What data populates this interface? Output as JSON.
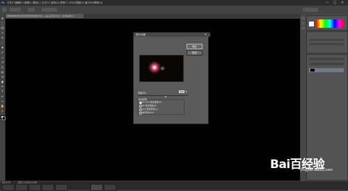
{
  "menubar": {
    "items": [
      "文件(F)",
      "编辑(E)",
      "图像(I)",
      "图层(L)",
      "文字(Y)",
      "选择(S)",
      "滤镜(T)",
      "3D(D)",
      "视图(V)",
      "窗口(W)",
      "帮助(H)"
    ]
  },
  "window_controls": {
    "minimize": "—",
    "maximize": "□",
    "close": "✕"
  },
  "document_tab": {
    "label": "08B0F8EA8C5C6D9E7A5E4BC7D5... jpg @ 66.7% (... RGB/8#) ×"
  },
  "dialog": {
    "title": "镜头光晕",
    "close_glyph": "✕",
    "ok_label": "确定",
    "cancel_label": "取消",
    "brightness_label": "亮度(B):",
    "brightness_value": "100",
    "brightness_unit": "%",
    "brightness_level": 0.0,
    "lens_type_title": "镜头类型",
    "lens_types": [
      {
        "label": "50-300 毫米变焦(Z)",
        "selected": true
      },
      {
        "label": "35 毫米聚焦(K)",
        "selected": false
      },
      {
        "label": "105 毫米聚焦(L)",
        "selected": false
      },
      {
        "label": "电影镜头(M)",
        "selected": false
      }
    ]
  },
  "statusbar": {
    "zoom": "66.67%",
    "doc": "文档:3.00M/3.00M"
  },
  "watermark": {
    "logo": "Bai百经验",
    "url": "jingyan.baidu.com"
  }
}
